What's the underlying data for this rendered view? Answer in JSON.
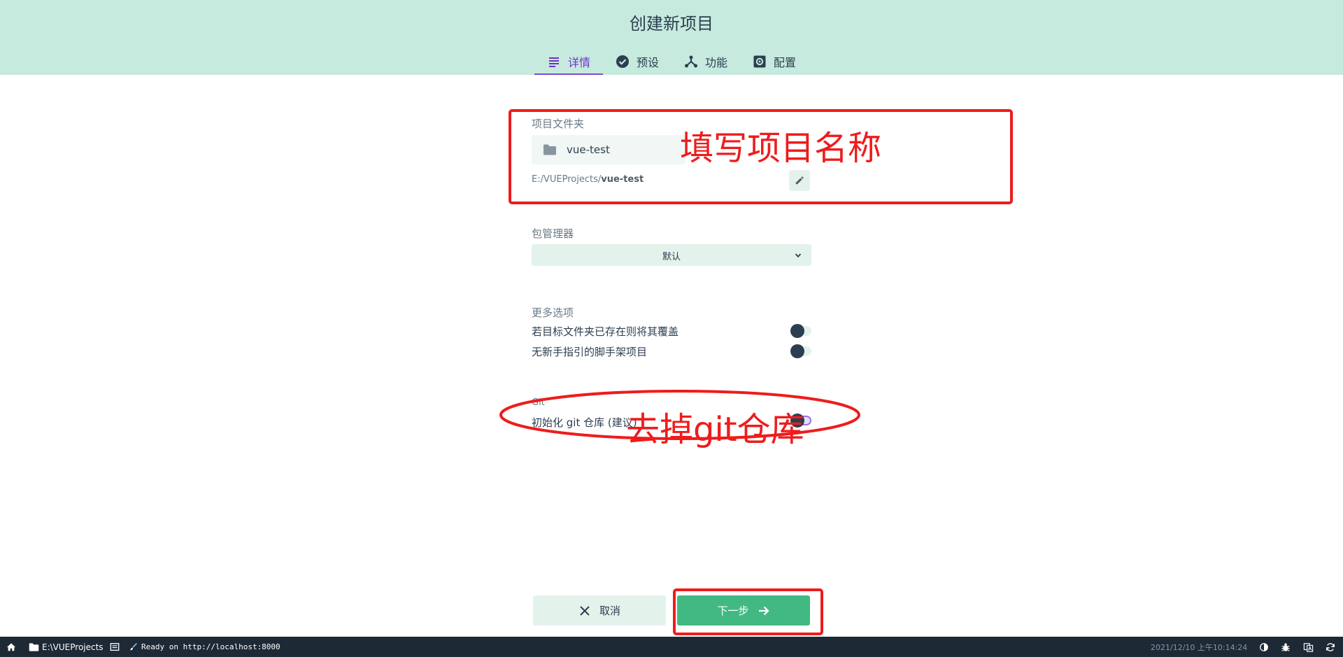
{
  "header": {
    "title": "创建新项目",
    "tabs": [
      {
        "label": "详情",
        "icon": "details-icon",
        "active": true
      },
      {
        "label": "预设",
        "icon": "check-circle-icon",
        "active": false
      },
      {
        "label": "功能",
        "icon": "branch-icon",
        "active": false
      },
      {
        "label": "配置",
        "icon": "settings-icon",
        "active": false
      }
    ]
  },
  "folder": {
    "label": "项目文件夹",
    "value": "vue-test",
    "path_prefix": "E:/VUEProjects/",
    "path_name": "vue-test"
  },
  "package_manager": {
    "label": "包管理器",
    "selected": "默认"
  },
  "more_options": {
    "label": "更多选项",
    "items": [
      {
        "label": "若目标文件夹已存在则将其覆盖",
        "checked": false
      },
      {
        "label": "无新手指引的脚手架项目",
        "checked": false
      }
    ]
  },
  "git": {
    "label": "Git",
    "init_label": "初始化 git 仓库 (建议)",
    "checked": true
  },
  "actions": {
    "cancel": "取消",
    "next": "下一步"
  },
  "annotations": {
    "folder_note": "填写项目名称",
    "git_note": "去掉git仓库",
    "color": "#ee1c1c"
  },
  "statusbar": {
    "folder": "E:\\VUEProjects",
    "ready": "Ready on http://localhost:8000",
    "datetime": "2021/12/10 上午10:14:24"
  },
  "colors": {
    "header_bg": "#c6eadd",
    "accent": "#7e4ad6",
    "primary": "#42b983",
    "statusbar_bg": "#1d2935"
  }
}
